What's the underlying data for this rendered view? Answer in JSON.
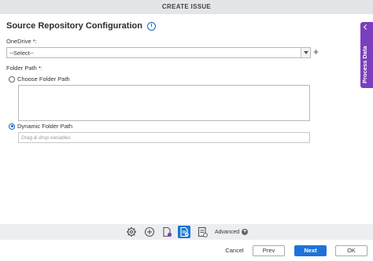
{
  "window": {
    "title": "CREATE ISSUE"
  },
  "page": {
    "heading": "Source Repository Configuration",
    "info_icon": "info-icon"
  },
  "fields": {
    "onedrive_label": "OneDrive *:",
    "onedrive_value": "--Select--",
    "folder_path_label": "Folder Path *:",
    "choose_folder_label": "Choose Folder Path",
    "dynamic_folder_label": "Dynamic Folder Path",
    "dynamic_placeholder": "Drag & drop variables",
    "selected_option": "Dynamic Folder Path"
  },
  "side_panel": {
    "label": "Process Data"
  },
  "toolbar": {
    "icons": [
      "gear-icon",
      "add-circle-icon",
      "document-settings-icon",
      "source-config-icon",
      "checklist-icon"
    ],
    "active_icon": "source-config-icon",
    "advanced_label": "Advanced"
  },
  "footer": {
    "cancel_label": "Cancel",
    "prev_label": "Prev",
    "next_label": "Next",
    "ok_label": "OK"
  },
  "colors": {
    "accent": "#1e73d9",
    "side_panel": "#7b3fbd",
    "titlebar": "#e4e5e9"
  }
}
